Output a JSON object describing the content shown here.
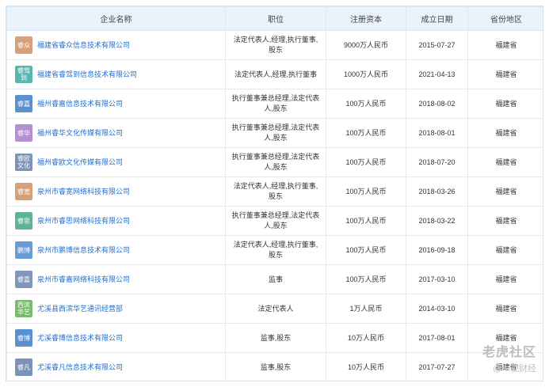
{
  "headers": [
    "企业名称",
    "职位",
    "注册资本",
    "成立日期",
    "省份地区"
  ],
  "rows": [
    {
      "logo": "睿众",
      "logo_color": "#d6a07a",
      "name": "福建省睿众信息技术有限公司",
      "position": "法定代表人,经理,执行董事,股东",
      "capital": "9000万人民币",
      "date": "2015-07-27",
      "region": "福建省"
    },
    {
      "logo": "睿驾到",
      "logo_color": "#58b7ad",
      "name": "福建省睿驾到信息技术有限公司",
      "position": "法定代表人,经理,执行董事",
      "capital": "1000万人民币",
      "date": "2021-04-13",
      "region": "福建省"
    },
    {
      "logo": "睿嘉",
      "logo_color": "#5b8fce",
      "name": "福州睿嘉信息技术有限公司",
      "position": "执行董事兼总经理,法定代表人,股东",
      "capital": "100万人民币",
      "date": "2018-08-02",
      "region": "福建省"
    },
    {
      "logo": "睿华",
      "logo_color": "#b48fd1",
      "name": "福州睿华文化传媒有限公司",
      "position": "执行董事兼总经理,法定代表人,股东",
      "capital": "100万人民币",
      "date": "2018-08-01",
      "region": "福建省"
    },
    {
      "logo": "睿欧文化",
      "logo_color": "#7b93b6",
      "name": "福州睿欧文化传媒有限公司",
      "position": "执行董事兼总经理,法定代表人,股东",
      "capital": "100万人民币",
      "date": "2018-07-20",
      "region": "福建省"
    },
    {
      "logo": "睿宽",
      "logo_color": "#d6a07a",
      "name": "泉州市睿宽网络科技有限公司",
      "position": "法定代表人,经理,执行董事,股东",
      "capital": "100万人民币",
      "date": "2018-03-26",
      "region": "福建省"
    },
    {
      "logo": "睿思",
      "logo_color": "#5fb39a",
      "name": "泉州市睿思网络科技有限公司",
      "position": "执行董事兼总经理,法定代表人,股东",
      "capital": "100万人民币",
      "date": "2018-03-22",
      "region": "福建省"
    },
    {
      "logo": "鹏博",
      "logo_color": "#6a9cd6",
      "name": "泉州市鹏博信息技术有限公司",
      "position": "法定代表人,经理,执行董事,股东",
      "capital": "100万人民币",
      "date": "2016-09-18",
      "region": "福建省"
    },
    {
      "logo": "睿嘉",
      "logo_color": "#7f97bd",
      "name": "泉州市睿嘉网络科技有限公司",
      "position": "监事",
      "capital": "100万人民币",
      "date": "2017-03-10",
      "region": "福建省"
    },
    {
      "logo": "西滨华艺",
      "logo_color": "#79bb6d",
      "name": "尤溪县西滨华艺通讯经营部",
      "position": "法定代表人",
      "capital": "1万人民币",
      "date": "2014-03-10",
      "region": "福建省"
    },
    {
      "logo": "睿博",
      "logo_color": "#5a8fd0",
      "name": "尤溪睿博信息技术有限公司",
      "position": "监事,股东",
      "capital": "10万人民币",
      "date": "2017-08-01",
      "region": "福建省"
    },
    {
      "logo": "睿凡",
      "logo_color": "#7b93b6",
      "name": "尤溪睿凡信息技术有限公司",
      "position": "监事,股东",
      "capital": "10万人民币",
      "date": "2017-07-27",
      "region": "福建省"
    }
  ],
  "watermark": {
    "line1": "老虎社区",
    "line2": "@一视财经"
  }
}
